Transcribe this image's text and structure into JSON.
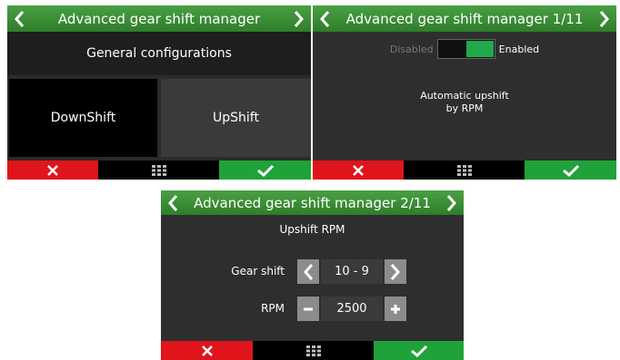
{
  "screen1": {
    "title": "Advanced gear shift manager",
    "menu": {
      "general": "General configurations",
      "downshift": "DownShift",
      "upshift": "UpShift"
    }
  },
  "screen2": {
    "title": "Advanced gear shift manager 1/11",
    "toggle": {
      "off_label": "Disabled",
      "on_label": "Enabled",
      "state": "Enabled"
    },
    "description_line1": "Automatic upshift",
    "description_line2": "by RPM"
  },
  "screen3": {
    "title": "Advanced gear shift manager  2/11",
    "section_title": "Upshift RPM",
    "gear_shift": {
      "label": "Gear shift",
      "value": "10 - 9"
    },
    "rpm": {
      "label": "RPM",
      "value": "2500"
    }
  },
  "icons": {
    "back": "chevron-left-icon",
    "next": "chevron-right-icon",
    "cancel": "close-icon",
    "menu": "grid-icon",
    "confirm": "check-icon",
    "decrease": "minus-icon",
    "increase": "plus-icon"
  },
  "colors": {
    "title_green": "#3b8f36",
    "cancel_red": "#e0141b",
    "confirm_green": "#20a23a",
    "toggle_green": "#1faa4b",
    "background": "#2b2b2b"
  }
}
